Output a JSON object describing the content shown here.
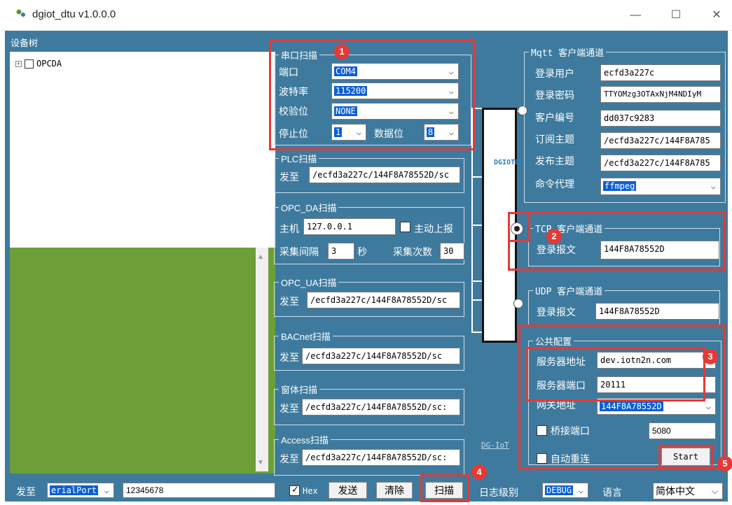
{
  "window": {
    "title": "dgiot_dtu v1.0.0.0",
    "minimize": "—",
    "maximize": "☐",
    "close": "✕"
  },
  "device_tree": {
    "label": "设备树",
    "root_node": "OPCDA"
  },
  "serial_scan": {
    "title": "串口扫描",
    "port_label": "端口",
    "port_value": "COM4",
    "baud_label": "波特率",
    "baud_value": "115200",
    "parity_label": "校验位",
    "parity_value": "NONE",
    "stopbits_label": "停止位",
    "stopbits_value": "1",
    "databits_label": "数据位",
    "databits_value": "8"
  },
  "plc_scan": {
    "title": "PLC扫描",
    "send_label": "发至",
    "topic": "/ecfd3a227c/144F8A78552D/sc"
  },
  "opc_da": {
    "title": "OPC_DA扫描",
    "host_label": "主机",
    "host_value": "127.0.0.1",
    "auto_report_label": "主动上报",
    "interval_label": "采集间隔",
    "interval_value": "3",
    "interval_unit": "秒",
    "count_label": "采集次数",
    "count_value": "30"
  },
  "opc_ua": {
    "title": "OPC_UA扫描",
    "send_label": "发至",
    "topic": "/ecfd3a227c/144F8A78552D/sc"
  },
  "bacnet": {
    "title": "BACnet扫描",
    "send_label": "发至",
    "topic": "/ecfd3a227c/144F8A78552D/sc"
  },
  "window_scan": {
    "title": "窗体扫描",
    "send_label": "发至",
    "topic": "/ecfd3a227c/144F8A78552D/sc:"
  },
  "access_scan": {
    "title": "Access扫描",
    "send_label": "发至",
    "topic": "/ecfd3a227c/144F8A78552D/sc:"
  },
  "bus": {
    "letters": "DGIOTDTU",
    "footer": "DG-IoT"
  },
  "mqtt": {
    "title": "Mqtt 客户端通道",
    "user_label": "登录用户",
    "user_value": "ecfd3a227c",
    "password_label": "登录密码",
    "password_value": "TTYOMzg3OTAxNjM4NDIyM",
    "client_label": "客户编号",
    "client_value": "dd037c9283",
    "sub_label": "订阅主题",
    "sub_value": "/ecfd3a227c/144F8A785",
    "pub_label": "发布主题",
    "pub_value": "/ecfd3a227c/144F8A785",
    "proxy_label": "命令代理",
    "proxy_value": "ffmpeg"
  },
  "tcp": {
    "title": "TCP 客户端通道",
    "login_label": "登录报文",
    "login_value": "144F8A78552D"
  },
  "udp": {
    "title": "UDP 客户端通道",
    "login_label": "登录报文",
    "login_value": "144F8A78552D"
  },
  "common": {
    "title": "公共配置",
    "server_label": "服务器地址",
    "server_value": "dev.iotn2n.com",
    "port_label": "服务器端口",
    "port_value": "20111",
    "gateway_label": "网关地址",
    "gateway_value": "144F8A78552D",
    "bridge_label": "桥接端口",
    "bridge_value": "5080",
    "reconnect_label": "自动重连",
    "start_label": "Start"
  },
  "bottom": {
    "send_label": "发至",
    "target_value": "erialPort",
    "payload_value": "12345678",
    "hex_label": "Hex",
    "send_button": "发送",
    "clear_button": "清除",
    "scan_button": "扫描",
    "log_level_label": "日志级别",
    "log_level_value": "DEBUG",
    "language_label": "语言",
    "language_value": "简体中文"
  },
  "annotations": [
    "1",
    "2",
    "3",
    "4",
    "5"
  ]
}
